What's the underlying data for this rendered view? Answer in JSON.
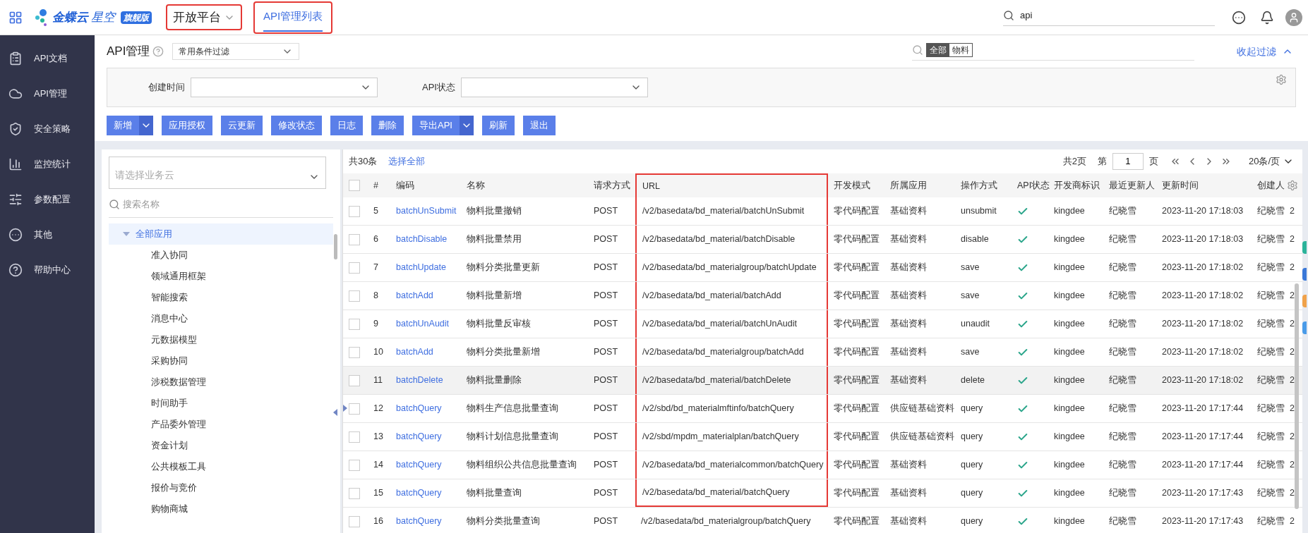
{
  "topbar": {
    "logo": {
      "brand": "金蝶云",
      "product": "星空",
      "badge": "旗舰版"
    },
    "platform": {
      "title": "开放平台",
      "annotated": true
    },
    "tabs": [
      {
        "label": "API管理列表",
        "selected": true,
        "annotated": true
      }
    ],
    "search": {
      "value": "api"
    }
  },
  "sidebar": {
    "items": [
      {
        "label": "API文档"
      },
      {
        "label": "API管理"
      },
      {
        "label": "安全策略"
      },
      {
        "label": "监控统计"
      },
      {
        "label": "参数配置"
      },
      {
        "label": "其他"
      },
      {
        "label": "帮助中心"
      }
    ]
  },
  "page_header": {
    "title": "API管理",
    "scheme": "常用条件过滤",
    "search_chips": [
      {
        "label": "全部",
        "selected": true
      },
      {
        "label": "物料",
        "selected": false
      }
    ],
    "collapse_link": "收起过滤"
  },
  "filters": [
    {
      "label": "创建时间"
    },
    {
      "label": "API状态"
    }
  ],
  "toolbar": [
    {
      "label": "新增",
      "split": true
    },
    {
      "label": "应用授权",
      "split": false
    },
    {
      "label": "云更新",
      "split": false
    },
    {
      "label": "修改状态",
      "split": false
    },
    {
      "label": "日志",
      "split": false
    },
    {
      "label": "删除",
      "split": false
    },
    {
      "label": "导出API",
      "split": true
    },
    {
      "label": "刷新",
      "split": false
    },
    {
      "label": "退出",
      "split": false
    }
  ],
  "tree": {
    "cloud_select": {
      "placeholder": "请选择业务云"
    },
    "search": {
      "placeholder": "搜索名称"
    },
    "nodes": [
      {
        "label": "全部应用",
        "expanded": true,
        "selected": true,
        "children": [
          {
            "label": "准入协同"
          },
          {
            "label": "领域通用框架"
          },
          {
            "label": "智能搜索"
          },
          {
            "label": "消息中心"
          },
          {
            "label": "元数据模型"
          },
          {
            "label": "采购协同"
          },
          {
            "label": "涉税数据管理"
          },
          {
            "label": "时间助手"
          },
          {
            "label": "产品委外管理"
          },
          {
            "label": "资金计划"
          },
          {
            "label": "公共模板工具"
          },
          {
            "label": "报价与竞价"
          },
          {
            "label": "购物商城"
          }
        ]
      }
    ]
  },
  "table": {
    "header_checked": false,
    "total": "共30条",
    "select_all": "选择全部",
    "pager": {
      "pages": "共2页",
      "page_prefix": "第",
      "page": "1",
      "page_suffix": "页",
      "page_size": "20条/页"
    },
    "columns": [
      {
        "label": "#",
        "annotated": false
      },
      {
        "label": "编码",
        "annotated": false
      },
      {
        "label": "名称",
        "annotated": false
      },
      {
        "label": "请求方式",
        "annotated": false
      },
      {
        "label": "URL",
        "annotated": true
      },
      {
        "label": "开发模式",
        "annotated": false
      },
      {
        "label": "所属应用",
        "annotated": false
      },
      {
        "label": "操作方式",
        "annotated": false
      },
      {
        "label": "API状态",
        "annotated": false
      },
      {
        "label": "开发商标识",
        "annotated": false
      },
      {
        "label": "最近更新人",
        "annotated": false
      },
      {
        "label": "更新时间",
        "annotated": false
      },
      {
        "label": "创建人",
        "annotated": false
      }
    ],
    "rows": [
      {
        "no": "5",
        "code": "batchUnSubmit",
        "name": "物料批量撤销",
        "method": "POST",
        "url": "/v2/basedata/bd_material/batchUnSubmit",
        "mode": "零代码配置",
        "app": "基础资料",
        "op": "unsubmit",
        "status_ok": true,
        "vendor": "kingdee",
        "updater": "纪晓雪",
        "time": "2023-11-20 17:18:03",
        "creator": "纪晓雪",
        "column_15": "2",
        "checked": false,
        "selected": false,
        "current": false,
        "url_annotated": true
      },
      {
        "no": "6",
        "code": "batchDisable",
        "name": "物料批量禁用",
        "method": "POST",
        "url": "/v2/basedata/bd_material/batchDisable",
        "mode": "零代码配置",
        "app": "基础资料",
        "op": "disable",
        "status_ok": true,
        "vendor": "kingdee",
        "updater": "纪晓雪",
        "time": "2023-11-20 17:18:03",
        "creator": "纪晓雪",
        "column_15": "2",
        "checked": false,
        "selected": false,
        "current": false,
        "url_annotated": true
      },
      {
        "no": "7",
        "code": "batchUpdate",
        "name": "物料分类批量更新",
        "method": "POST",
        "url": "/v2/basedata/bd_materialgroup/batchUpdate",
        "mode": "零代码配置",
        "app": "基础资料",
        "op": "save",
        "status_ok": true,
        "vendor": "kingdee",
        "updater": "纪晓雪",
        "time": "2023-11-20 17:18:02",
        "creator": "纪晓雪",
        "column_15": "2",
        "checked": false,
        "selected": false,
        "current": false,
        "url_annotated": true
      },
      {
        "no": "8",
        "code": "batchAdd",
        "name": "物料批量新增",
        "method": "POST",
        "url": "/v2/basedata/bd_material/batchAdd",
        "mode": "零代码配置",
        "app": "基础资料",
        "op": "save",
        "status_ok": true,
        "vendor": "kingdee",
        "updater": "纪晓雪",
        "time": "2023-11-20 17:18:02",
        "creator": "纪晓雪",
        "column_15": "2",
        "checked": false,
        "selected": false,
        "current": false,
        "url_annotated": true
      },
      {
        "no": "9",
        "code": "batchUnAudit",
        "name": "物料批量反审核",
        "method": "POST",
        "url": "/v2/basedata/bd_material/batchUnAudit",
        "mode": "零代码配置",
        "app": "基础资料",
        "op": "unaudit",
        "status_ok": true,
        "vendor": "kingdee",
        "updater": "纪晓雪",
        "time": "2023-11-20 17:18:02",
        "creator": "纪晓雪",
        "column_15": "2",
        "checked": false,
        "selected": false,
        "current": false,
        "url_annotated": true
      },
      {
        "no": "10",
        "code": "batchAdd",
        "name": "物料分类批量新增",
        "method": "POST",
        "url": "/v2/basedata/bd_materialgroup/batchAdd",
        "mode": "零代码配置",
        "app": "基础资料",
        "op": "save",
        "status_ok": true,
        "vendor": "kingdee",
        "updater": "纪晓雪",
        "time": "2023-11-20 17:18:02",
        "creator": "纪晓雪",
        "column_15": "2",
        "checked": false,
        "selected": false,
        "current": false,
        "url_annotated": true
      },
      {
        "no": "11",
        "code": "batchDelete",
        "name": "物料批量删除",
        "method": "POST",
        "url": "/v2/basedata/bd_material/batchDelete",
        "mode": "零代码配置",
        "app": "基础资料",
        "op": "delete",
        "status_ok": true,
        "vendor": "kingdee",
        "updater": "纪晓雪",
        "time": "2023-11-20 17:18:02",
        "creator": "纪晓雪",
        "column_15": "2",
        "checked": false,
        "selected": true,
        "current": false,
        "url_annotated": true
      },
      {
        "no": "12",
        "code": "batchQuery",
        "name": "物料生产信息批量查询",
        "method": "POST",
        "url": "/v2/sbd/bd_materialmftinfo/batchQuery",
        "mode": "零代码配置",
        "app": "供应链基础资料",
        "op": "query",
        "status_ok": true,
        "vendor": "kingdee",
        "updater": "纪晓雪",
        "time": "2023-11-20 17:17:44",
        "creator": "纪晓雪",
        "column_15": "2",
        "checked": false,
        "selected": false,
        "current": true,
        "url_annotated": true
      },
      {
        "no": "13",
        "code": "batchQuery",
        "name": "物料计划信息批量查询",
        "method": "POST",
        "url": "/v2/sbd/mpdm_materialplan/batchQuery",
        "mode": "零代码配置",
        "app": "供应链基础资料",
        "op": "query",
        "status_ok": true,
        "vendor": "kingdee",
        "updater": "纪晓雪",
        "time": "2023-11-20 17:17:44",
        "creator": "纪晓雪",
        "column_15": "2",
        "checked": false,
        "selected": false,
        "current": false,
        "url_annotated": true
      },
      {
        "no": "14",
        "code": "batchQuery",
        "name": "物料组织公共信息批量查询",
        "method": "POST",
        "url": "/v2/basedata/bd_materialcommon/batchQuery",
        "mode": "零代码配置",
        "app": "基础资料",
        "op": "query",
        "status_ok": true,
        "vendor": "kingdee",
        "updater": "纪晓雪",
        "time": "2023-11-20 17:17:44",
        "creator": "纪晓雪",
        "column_15": "2",
        "checked": false,
        "selected": false,
        "current": false,
        "url_annotated": true
      },
      {
        "no": "15",
        "code": "batchQuery",
        "name": "物料批量查询",
        "method": "POST",
        "url": "/v2/basedata/bd_material/batchQuery",
        "mode": "零代码配置",
        "app": "基础资料",
        "op": "query",
        "status_ok": true,
        "vendor": "kingdee",
        "updater": "纪晓雪",
        "time": "2023-11-20 17:17:43",
        "creator": "纪晓雪",
        "column_15": "2",
        "checked": false,
        "selected": false,
        "current": false,
        "url_annotated": true
      },
      {
        "no": "16",
        "code": "batchQuery",
        "name": "物料分类批量查询",
        "method": "POST",
        "url": "/v2/basedata/bd_materialgroup/batchQuery",
        "mode": "零代码配置",
        "app": "基础资料",
        "op": "query",
        "status_ok": true,
        "vendor": "kingdee",
        "updater": "纪晓雪",
        "time": "2023-11-20 17:17:43",
        "creator": "纪晓雪",
        "column_15": "2",
        "checked": false,
        "selected": false,
        "current": false,
        "url_annotated": false
      }
    ]
  },
  "side_tabs": [
    {
      "color": "#2bb39a"
    },
    {
      "color": "#3a78d8"
    },
    {
      "color": "#f0a24a"
    },
    {
      "color": "#4a9be8"
    }
  ]
}
